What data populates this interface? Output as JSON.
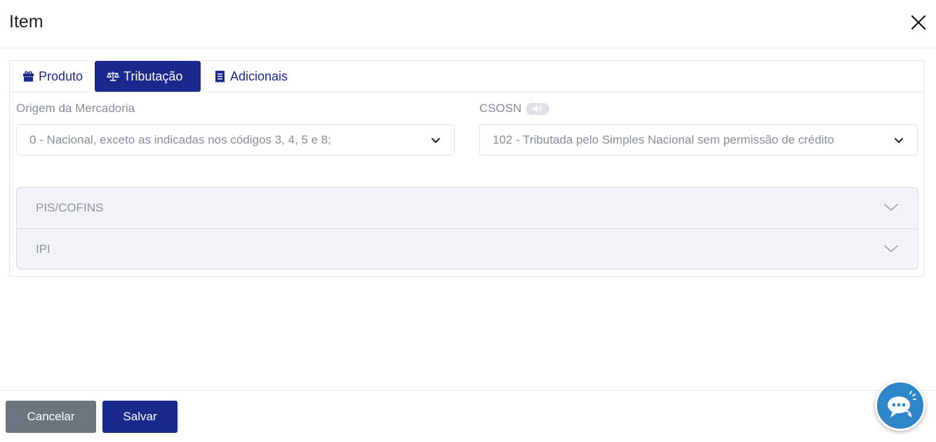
{
  "modal": {
    "title": "Item"
  },
  "tabs": [
    {
      "label": "Produto",
      "icon": "gift-icon",
      "active": false
    },
    {
      "label": "Tributação",
      "icon": "balance-scale-icon",
      "active": true
    },
    {
      "label": "Adicionais",
      "icon": "receipt-icon",
      "active": false
    }
  ],
  "form": {
    "origem": {
      "label": "Origem da Mercadoria",
      "value": "0 - Nacional, exceto as indicadas nos códigos 3, 4, 5 e 8;"
    },
    "csosn": {
      "label": "CSOSN",
      "value": "102 - Tributada pelo Simples Nacional sem permissão de crédito",
      "info_icon": "speaker-icon"
    }
  },
  "accordion": [
    {
      "label": "PIS/COFINS"
    },
    {
      "label": "IPI"
    }
  ],
  "footer": {
    "cancel_label": "Cancelar",
    "save_label": "Salvar"
  },
  "colors": {
    "primary": "#1a2a8c",
    "secondary": "#6c757d",
    "chat": "#2e86c8"
  }
}
